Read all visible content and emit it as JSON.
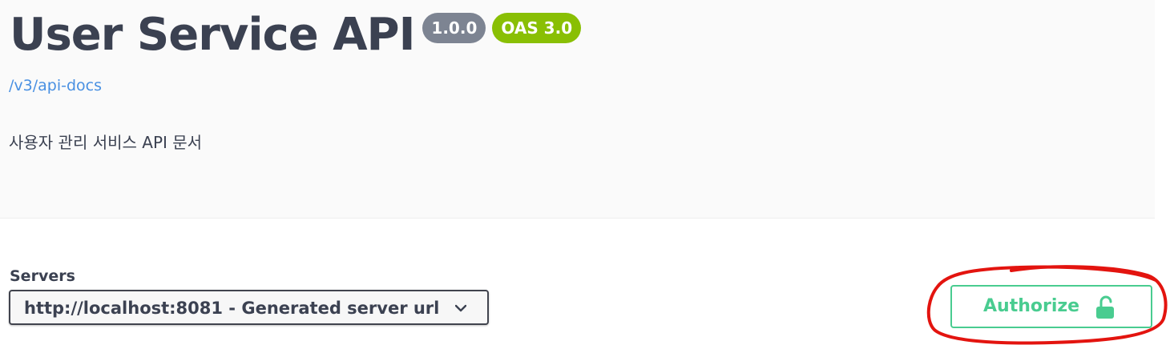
{
  "info": {
    "title": "User Service API",
    "version": "1.0.0",
    "oas": "OAS 3.0",
    "spec_link": "/v3/api-docs",
    "description": "사용자 관리 서비스 API 문서"
  },
  "servers": {
    "label": "Servers",
    "selected": "http://localhost:8081 - Generated server url"
  },
  "authorize": {
    "label": "Authorize"
  },
  "colors": {
    "accent_green": "#49cc90",
    "badge_gray": "#7d8492",
    "badge_green": "#89bf04",
    "link_blue": "#4990e2",
    "annotation_red": "#e3140f"
  },
  "icons": {
    "select_chevron": "chevron-down-icon",
    "authorize": "unlocked-padlock-icon"
  }
}
